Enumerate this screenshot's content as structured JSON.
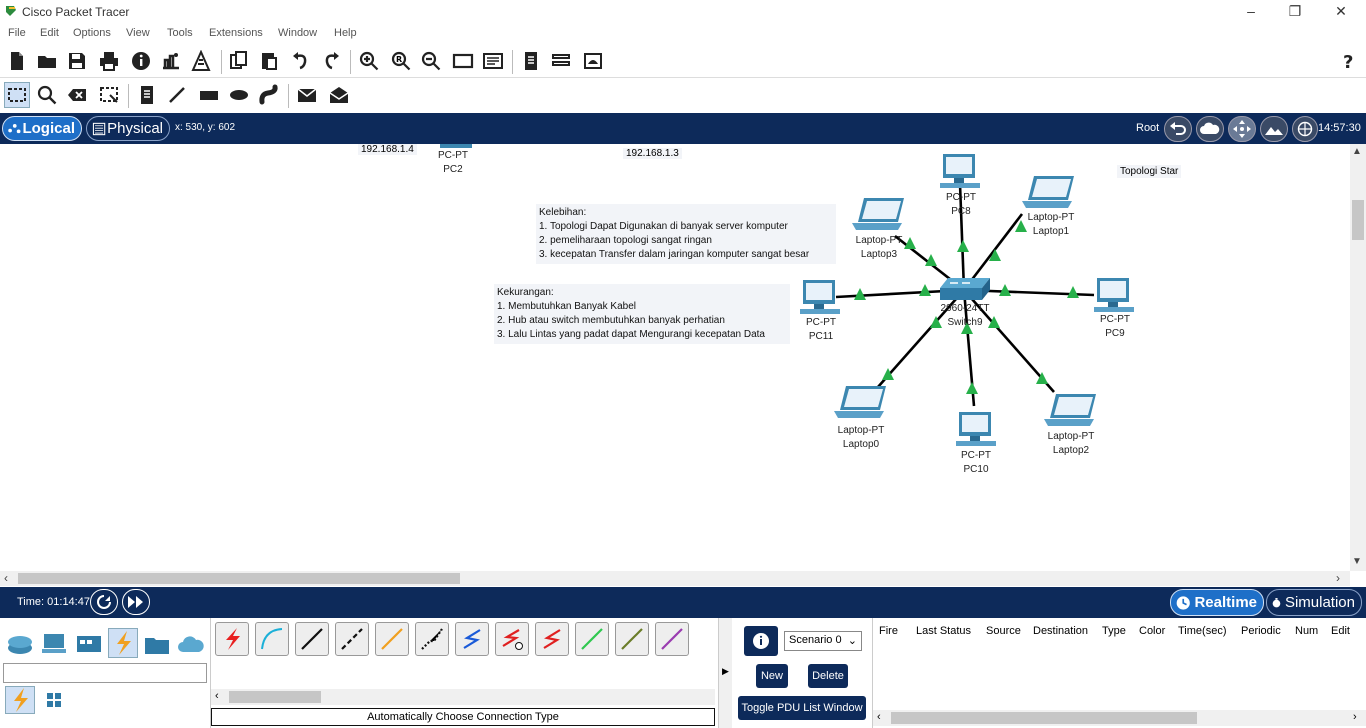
{
  "window": {
    "title": "Cisco Packet Tracer"
  },
  "menu": [
    "File",
    "Edit",
    "Options",
    "View",
    "Tools",
    "Extensions",
    "Window",
    "Help"
  ],
  "toolbar_main": [
    "new-file-icon",
    "open-folder-icon",
    "save-icon",
    "print-icon",
    "info-icon",
    "activity-wizard-icon",
    "pt-builder-icon",
    "copy-icon",
    "paste-icon",
    "undo-icon",
    "redo-icon",
    "zoom-in-icon",
    "zoom-reset-icon",
    "zoom-out-icon",
    "drawing-palette-icon",
    "custom-device-icon",
    "notes-icon",
    "viewport-icon",
    "cluster-icon",
    "help-icon"
  ],
  "toolbar_edit": [
    "select-icon",
    "inspect-icon",
    "delete-icon",
    "resize-icon",
    "note-icon",
    "line-icon",
    "rectangle-icon",
    "ellipse-icon",
    "freeform-icon",
    "simple-pdu-icon",
    "complex-pdu-icon"
  ],
  "workspace": {
    "logical_label": "Logical",
    "physical_label": "Physical",
    "coords": "x: 530, y: 602",
    "root_label": "Root",
    "clock": "14:57:30"
  },
  "canvas": {
    "ip_labels": [
      "192.168.1.4",
      "192.168.1.3"
    ],
    "top_label": "Topologi Star",
    "pc2": {
      "type": "PC-PT",
      "name": "PC2"
    },
    "devices": [
      {
        "type": "PC-PT",
        "name": "PC8"
      },
      {
        "type": "Laptop-PT",
        "name": "Laptop1"
      },
      {
        "type": "Laptop-PT",
        "name": "Laptop3"
      },
      {
        "type": "2960-24TT",
        "name": "Switch9"
      },
      {
        "type": "PC-PT",
        "name": "PC11"
      },
      {
        "type": "PC-PT",
        "name": "PC9"
      },
      {
        "type": "Laptop-PT",
        "name": "Laptop0"
      },
      {
        "type": "PC-PT",
        "name": "PC10"
      },
      {
        "type": "Laptop-PT",
        "name": "Laptop2"
      }
    ],
    "note_kelebihan": [
      "Kelebihan:",
      "1. Topologi Dapat Digunakan di banyak server komputer",
      "2. pemeliharaan topologi sangat ringan",
      "3. kecepatan Transfer dalam jaringan komputer sangat besar"
    ],
    "note_kekurangan": [
      "Kekurangan:",
      "1. Membutuhkan Banyak Kabel",
      "2. Hub atau switch membutuhkan banyak perhatian",
      "3. Lalu Lintas yang padat dapat Mengurangi kecepatan Data"
    ]
  },
  "timebar": {
    "time": "Time: 01:14:47",
    "realtime": "Realtime",
    "simulation": "Simulation"
  },
  "bottom": {
    "connection_type": "Automatically Choose Connection Type",
    "scenario": "Scenario 0",
    "new_button": "New",
    "delete_button": "Delete",
    "toggle_pdu": "Toggle PDU List Window",
    "pdu_columns": [
      "Fire",
      "Last Status",
      "Source",
      "Destination",
      "Type",
      "Color",
      "Time(sec)",
      "Periodic",
      "Num",
      "Edit"
    ],
    "cable_colors": [
      "#e82020",
      "#1bb0d8",
      "#111111",
      "#111111",
      "#f0a020",
      "#111111",
      "#1a5ad8",
      "#e02020",
      "#e02020",
      "#30c850",
      "#6b7d2a",
      "#9a3cb0"
    ]
  }
}
